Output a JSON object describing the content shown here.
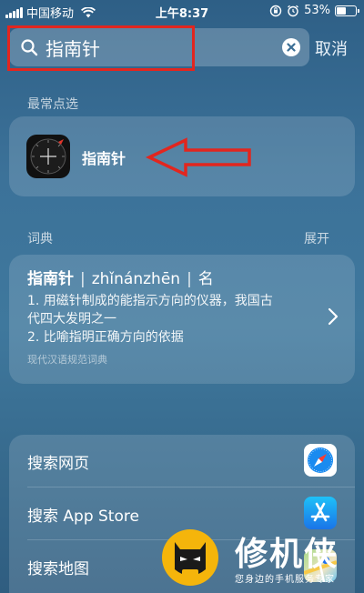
{
  "status_bar": {
    "carrier": "中国移动",
    "time": "上午8:37",
    "battery": "53%",
    "battery_level": 0.53,
    "icons": [
      "signal-icon",
      "wifi-icon",
      "orientation-lock-icon",
      "alarm-icon",
      "battery-icon"
    ]
  },
  "search": {
    "query": "指南针",
    "cancel_label": "取消"
  },
  "top_hits": {
    "section_label": "最常点选",
    "app": {
      "name": "指南针",
      "icon": "compass-app-icon"
    }
  },
  "dictionary": {
    "section_label": "词典",
    "expand_label": "展开",
    "word": "指南针",
    "pinyin": "zhǐnánzhēn",
    "part_of_speech": "名",
    "definitions": [
      "1. 用磁针制成的能指示方向的仪器，我国古",
      "代四大发明之一",
      "2. 比喻指明正确方向的依据"
    ],
    "source": "现代汉语规范词典"
  },
  "more_results": [
    {
      "label": "搜索网页",
      "icon": "safari-icon"
    },
    {
      "label": "搜索 App Store",
      "icon": "app-store-icon"
    },
    {
      "label": "搜索地图",
      "icon": "maps-icon"
    }
  ],
  "watermark": {
    "title": "修机侠",
    "subtitle": "您身边的手机服务专家"
  },
  "colors": {
    "highlight_red": "#e2261f",
    "background_blue": "#3c7299"
  }
}
